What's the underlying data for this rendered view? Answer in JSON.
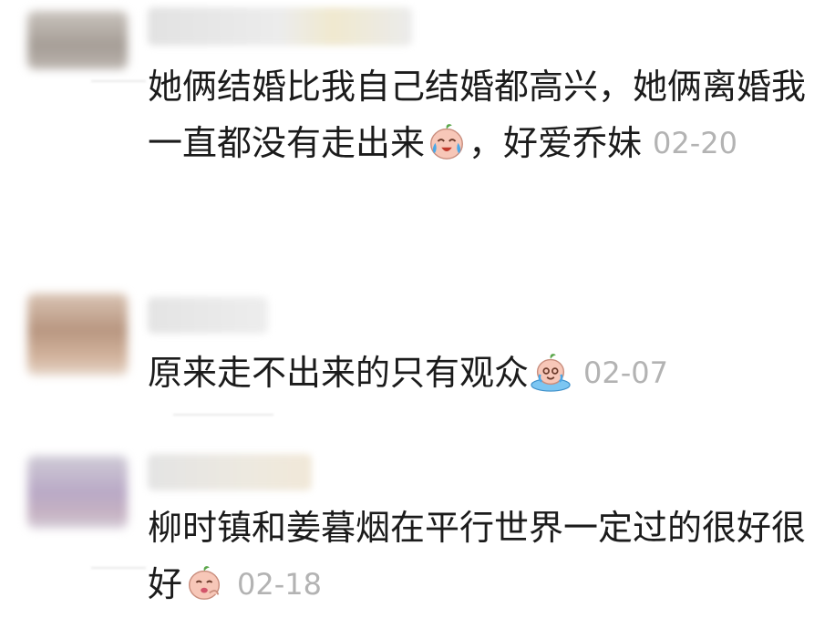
{
  "comments": [
    {
      "text_before": "她俩结婚比我自己结婚都高兴，她俩离婚我一直都没有走出来",
      "emoji": "crying-face-emoji",
      "text_after": "，好爱乔妹",
      "time": "02-20"
    },
    {
      "text_before": "原来走不出来的只有观众",
      "emoji": "sobbing-puddle-emoji",
      "text_after": "",
      "time": "02-07"
    },
    {
      "text_before": "柳时镇和姜暮烟在平行世界一定过的很好很好",
      "emoji": "cheeky-face-emoji",
      "text_after": "",
      "time": "02-18"
    }
  ],
  "colors": {
    "text": "#1b1b1b",
    "timestamp": "#b3b3b3",
    "emoji_face": "#f7c7b8",
    "emoji_leaf": "#5aa64a",
    "emoji_tear": "#4aa8e8"
  }
}
